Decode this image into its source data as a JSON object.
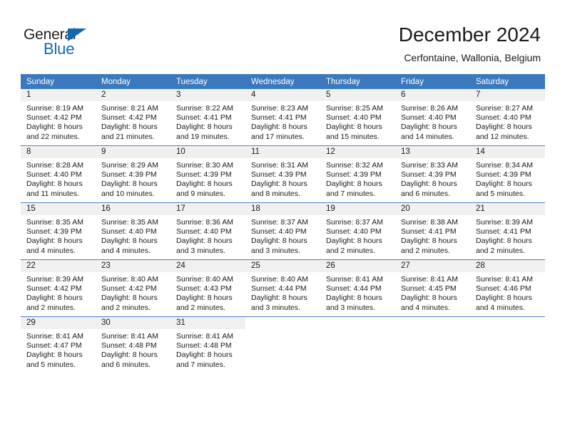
{
  "logo": {
    "text_primary": "General",
    "text_secondary": "Blue",
    "primary_color": "#231f20",
    "accent_color": "#1268b3",
    "triangle_icon": "triangle-icon"
  },
  "header": {
    "title": "December 2024",
    "subtitle": "Cerfontaine, Wallonia, Belgium"
  },
  "theme": {
    "header_bg": "#3a79bd",
    "daynum_bg": "#f0f0f0",
    "text": "#1a1a1a"
  },
  "calendar": {
    "weekday_headers": [
      "Sunday",
      "Monday",
      "Tuesday",
      "Wednesday",
      "Thursday",
      "Friday",
      "Saturday"
    ],
    "weeks": [
      [
        {
          "day": "1",
          "lines": [
            "Sunrise: 8:19 AM",
            "Sunset: 4:42 PM",
            "Daylight: 8 hours",
            "and 22 minutes."
          ]
        },
        {
          "day": "2",
          "lines": [
            "Sunrise: 8:21 AM",
            "Sunset: 4:42 PM",
            "Daylight: 8 hours",
            "and 21 minutes."
          ]
        },
        {
          "day": "3",
          "lines": [
            "Sunrise: 8:22 AM",
            "Sunset: 4:41 PM",
            "Daylight: 8 hours",
            "and 19 minutes."
          ]
        },
        {
          "day": "4",
          "lines": [
            "Sunrise: 8:23 AM",
            "Sunset: 4:41 PM",
            "Daylight: 8 hours",
            "and 17 minutes."
          ]
        },
        {
          "day": "5",
          "lines": [
            "Sunrise: 8:25 AM",
            "Sunset: 4:40 PM",
            "Daylight: 8 hours",
            "and 15 minutes."
          ]
        },
        {
          "day": "6",
          "lines": [
            "Sunrise: 8:26 AM",
            "Sunset: 4:40 PM",
            "Daylight: 8 hours",
            "and 14 minutes."
          ]
        },
        {
          "day": "7",
          "lines": [
            "Sunrise: 8:27 AM",
            "Sunset: 4:40 PM",
            "Daylight: 8 hours",
            "and 12 minutes."
          ]
        }
      ],
      [
        {
          "day": "8",
          "lines": [
            "Sunrise: 8:28 AM",
            "Sunset: 4:40 PM",
            "Daylight: 8 hours",
            "and 11 minutes."
          ]
        },
        {
          "day": "9",
          "lines": [
            "Sunrise: 8:29 AM",
            "Sunset: 4:39 PM",
            "Daylight: 8 hours",
            "and 10 minutes."
          ]
        },
        {
          "day": "10",
          "lines": [
            "Sunrise: 8:30 AM",
            "Sunset: 4:39 PM",
            "Daylight: 8 hours",
            "and 9 minutes."
          ]
        },
        {
          "day": "11",
          "lines": [
            "Sunrise: 8:31 AM",
            "Sunset: 4:39 PM",
            "Daylight: 8 hours",
            "and 8 minutes."
          ]
        },
        {
          "day": "12",
          "lines": [
            "Sunrise: 8:32 AM",
            "Sunset: 4:39 PM",
            "Daylight: 8 hours",
            "and 7 minutes."
          ]
        },
        {
          "day": "13",
          "lines": [
            "Sunrise: 8:33 AM",
            "Sunset: 4:39 PM",
            "Daylight: 8 hours",
            "and 6 minutes."
          ]
        },
        {
          "day": "14",
          "lines": [
            "Sunrise: 8:34 AM",
            "Sunset: 4:39 PM",
            "Daylight: 8 hours",
            "and 5 minutes."
          ]
        }
      ],
      [
        {
          "day": "15",
          "lines": [
            "Sunrise: 8:35 AM",
            "Sunset: 4:39 PM",
            "Daylight: 8 hours",
            "and 4 minutes."
          ]
        },
        {
          "day": "16",
          "lines": [
            "Sunrise: 8:35 AM",
            "Sunset: 4:40 PM",
            "Daylight: 8 hours",
            "and 4 minutes."
          ]
        },
        {
          "day": "17",
          "lines": [
            "Sunrise: 8:36 AM",
            "Sunset: 4:40 PM",
            "Daylight: 8 hours",
            "and 3 minutes."
          ]
        },
        {
          "day": "18",
          "lines": [
            "Sunrise: 8:37 AM",
            "Sunset: 4:40 PM",
            "Daylight: 8 hours",
            "and 3 minutes."
          ]
        },
        {
          "day": "19",
          "lines": [
            "Sunrise: 8:37 AM",
            "Sunset: 4:40 PM",
            "Daylight: 8 hours",
            "and 2 minutes."
          ]
        },
        {
          "day": "20",
          "lines": [
            "Sunrise: 8:38 AM",
            "Sunset: 4:41 PM",
            "Daylight: 8 hours",
            "and 2 minutes."
          ]
        },
        {
          "day": "21",
          "lines": [
            "Sunrise: 8:39 AM",
            "Sunset: 4:41 PM",
            "Daylight: 8 hours",
            "and 2 minutes."
          ]
        }
      ],
      [
        {
          "day": "22",
          "lines": [
            "Sunrise: 8:39 AM",
            "Sunset: 4:42 PM",
            "Daylight: 8 hours",
            "and 2 minutes."
          ]
        },
        {
          "day": "23",
          "lines": [
            "Sunrise: 8:40 AM",
            "Sunset: 4:42 PM",
            "Daylight: 8 hours",
            "and 2 minutes."
          ]
        },
        {
          "day": "24",
          "lines": [
            "Sunrise: 8:40 AM",
            "Sunset: 4:43 PM",
            "Daylight: 8 hours",
            "and 2 minutes."
          ]
        },
        {
          "day": "25",
          "lines": [
            "Sunrise: 8:40 AM",
            "Sunset: 4:44 PM",
            "Daylight: 8 hours",
            "and 3 minutes."
          ]
        },
        {
          "day": "26",
          "lines": [
            "Sunrise: 8:41 AM",
            "Sunset: 4:44 PM",
            "Daylight: 8 hours",
            "and 3 minutes."
          ]
        },
        {
          "day": "27",
          "lines": [
            "Sunrise: 8:41 AM",
            "Sunset: 4:45 PM",
            "Daylight: 8 hours",
            "and 4 minutes."
          ]
        },
        {
          "day": "28",
          "lines": [
            "Sunrise: 8:41 AM",
            "Sunset: 4:46 PM",
            "Daylight: 8 hours",
            "and 4 minutes."
          ]
        }
      ],
      [
        {
          "day": "29",
          "lines": [
            "Sunrise: 8:41 AM",
            "Sunset: 4:47 PM",
            "Daylight: 8 hours",
            "and 5 minutes."
          ]
        },
        {
          "day": "30",
          "lines": [
            "Sunrise: 8:41 AM",
            "Sunset: 4:48 PM",
            "Daylight: 8 hours",
            "and 6 minutes."
          ]
        },
        {
          "day": "31",
          "lines": [
            "Sunrise: 8:41 AM",
            "Sunset: 4:48 PM",
            "Daylight: 8 hours",
            "and 7 minutes."
          ]
        },
        {
          "day": "",
          "lines": []
        },
        {
          "day": "",
          "lines": []
        },
        {
          "day": "",
          "lines": []
        },
        {
          "day": "",
          "lines": []
        }
      ]
    ]
  }
}
